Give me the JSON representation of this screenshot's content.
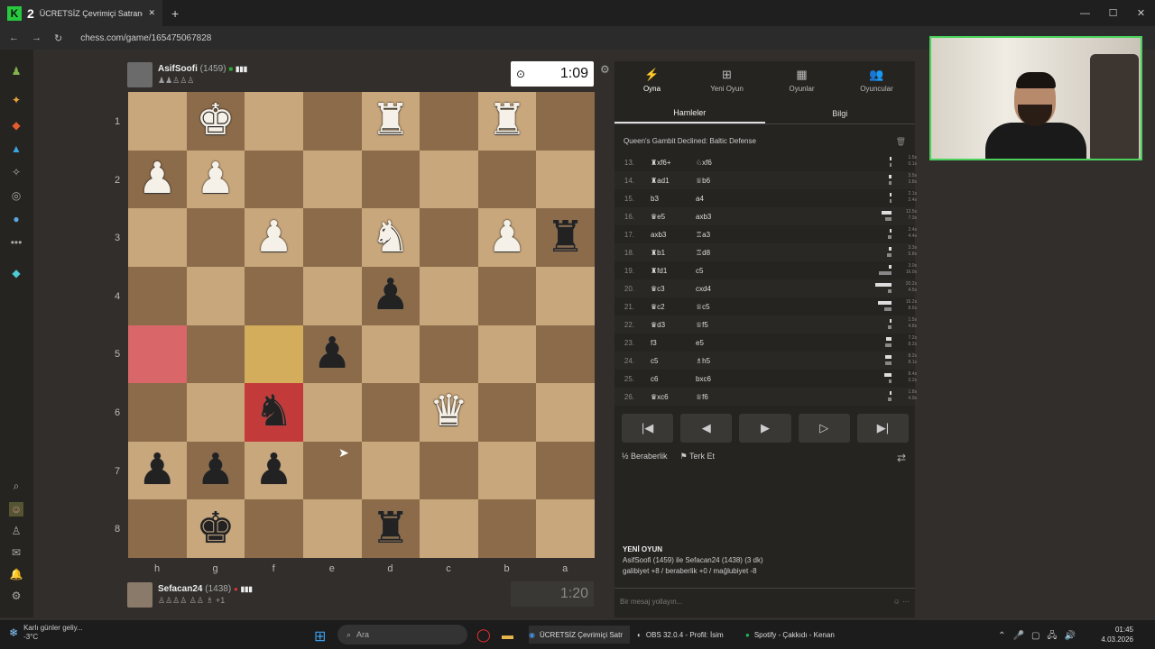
{
  "browser": {
    "tab_title": "ÜCRETSİZ Çevrimiçi Satranç Oy",
    "tab_badge": "2",
    "url": "chess.com/game/165475067828",
    "back": "←",
    "forward": "→",
    "reload": "↻",
    "new_tab": "+",
    "close_tab": "✕",
    "minimize": "—",
    "maximize": "☐",
    "close": "✕"
  },
  "players": {
    "top": {
      "name": "AsifSoofi",
      "rating": "(1459)",
      "captured": "♟♟♙♙♙"
    },
    "bottom": {
      "name": "Sefacan24",
      "rating": "(1438)",
      "captured": "♙♙♙♙ ♙♙ ♗ +1"
    }
  },
  "clocks": {
    "top": "1:09",
    "bottom": "1:20"
  },
  "board": {
    "ranks": [
      "1",
      "2",
      "3",
      "4",
      "5",
      "6",
      "7",
      "8"
    ],
    "files": [
      "h",
      "g",
      "f",
      "e",
      "d",
      "c",
      "b",
      "a"
    ],
    "pieces": [
      [
        "",
        "♚w",
        "",
        "",
        "♜w",
        "",
        "♜w",
        ""
      ],
      [
        "♟w",
        "♟w",
        "",
        "",
        "",
        "",
        "",
        ""
      ],
      [
        "",
        "",
        "♟w",
        "",
        "♞w",
        "",
        "♟w",
        "♜b"
      ],
      [
        "",
        "",
        "",
        "",
        "♟b",
        "",
        "",
        ""
      ],
      [
        "",
        "",
        "",
        "♟b",
        "",
        "",
        "",
        ""
      ],
      [
        "",
        "",
        "♞b",
        "",
        "",
        "♛w",
        "",
        ""
      ],
      [
        "♟b",
        "♟b",
        "♟b",
        "",
        "",
        "",
        "",
        ""
      ],
      [
        "",
        "♚b",
        "",
        "",
        "♜b",
        "",
        "",
        ""
      ]
    ]
  },
  "panel": {
    "tabs": [
      {
        "icon": "⚡",
        "label": "Oyna"
      },
      {
        "icon": "⊞",
        "label": "Yeni Oyun"
      },
      {
        "icon": "▦",
        "label": "Oyunlar"
      },
      {
        "icon": "👥",
        "label": "Oyuncular"
      }
    ],
    "subtabs": [
      "Hamleler",
      "Bilgi"
    ],
    "opening": "Queen's Gambit Declined: Baltic Defense",
    "moves": [
      {
        "n": "13.",
        "w": "♜xf6+",
        "b": "♘xf6",
        "tw": "1.5s",
        "tb": "0.1s"
      },
      {
        "n": "14.",
        "w": "♜ad1",
        "b": "♕b6",
        "tw": "3.5s",
        "tb": "3.8s"
      },
      {
        "n": "15.",
        "w": "b3",
        "b": "a4",
        "tw": "2.1s",
        "tb": "2.4s"
      },
      {
        "n": "16.",
        "w": "♛e5",
        "b": "axb3",
        "tw": "12.5s",
        "tb": "7.3s"
      },
      {
        "n": "17.",
        "w": "axb3",
        "b": "♖a3",
        "tw": "2.4s",
        "tb": "4.4s"
      },
      {
        "n": "18.",
        "w": "♜b1",
        "b": "♖d8",
        "tw": "3.3s",
        "tb": "5.8s"
      },
      {
        "n": "19.",
        "w": "♜fd1",
        "b": "c5",
        "tw": "3.0s",
        "tb": "16.0s"
      },
      {
        "n": "20.",
        "w": "♛c3",
        "b": "cxd4",
        "tw": "20.2s",
        "tb": "4.5s"
      },
      {
        "n": "21.",
        "w": "♛c2",
        "b": "♕c5",
        "tw": "16.2s",
        "tb": "8.6s"
      },
      {
        "n": "22.",
        "w": "♛d3",
        "b": "♕f5",
        "tw": "1.5s",
        "tb": "4.8s"
      },
      {
        "n": "23.",
        "w": "f3",
        "b": "e5",
        "tw": "7.2s",
        "tb": "8.2s"
      },
      {
        "n": "24.",
        "w": "c5",
        "b": "♗h5",
        "tw": "8.2s",
        "tb": "8.1s"
      },
      {
        "n": "25.",
        "w": "c6",
        "b": "bxc6",
        "tw": "8.4s",
        "tb": "3.2s"
      },
      {
        "n": "26.",
        "w": "♛xc6",
        "b": "♕f6",
        "tw": "1.8s",
        "tb": "4.9s"
      }
    ],
    "nav": [
      "|◀",
      "◀",
      "▶",
      "▷",
      "▶|"
    ],
    "draw": "Beraberlik",
    "resign": "Terk Et",
    "new_game_title": "YENİ OYUN",
    "new_game_line1": "AsifSoofi (1459) ile Sefacan24 (1438) (3 dk)",
    "new_game_line2": "galibiyet +8 / beraberlik +0 / mağlubiyet -8",
    "chat_placeholder": "Bir mesaj yollayın..."
  },
  "taskbar": {
    "weather_line1": "Karlı günler geliy...",
    "weather_line2": "-3°C",
    "search": "Ara",
    "items": [
      "ÜCRETSİZ Çevrimiçi Satr",
      "OBS 32.0.4 - Profil: İsim",
      "Spotify - Çakkıdı - Kenan"
    ],
    "time": "01:45",
    "date": "4.03.2026"
  }
}
